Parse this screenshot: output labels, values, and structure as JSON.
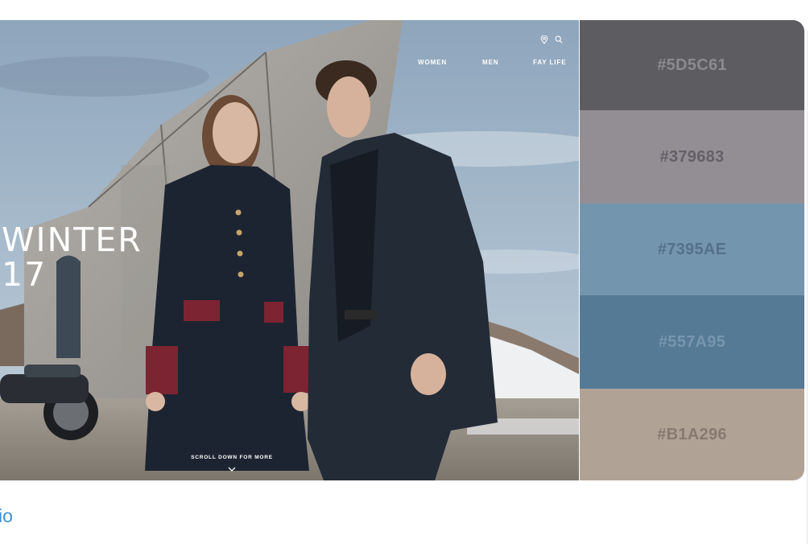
{
  "hero": {
    "nav_icons": [
      "location-pin-icon",
      "search-icon"
    ],
    "nav": [
      "WOMEN",
      "MEN",
      "FAY LIFE"
    ],
    "title_lines": [
      "WINTER",
      "17"
    ],
    "scroll_text": "SCROLL DOWN FOR MORE",
    "scroll_icon": "chevron-down-icon"
  },
  "palette": [
    {
      "label": "#5D5C61",
      "color": "#5D5C61"
    },
    {
      "label": "#379683",
      "color": "#938E94"
    },
    {
      "label": "#7395AE",
      "color": "#7395AE"
    },
    {
      "label": "#557A95",
      "color": "#557A95"
    },
    {
      "label": "#B1A296",
      "color": "#B1A296"
    }
  ],
  "footer": {
    "link": "io"
  }
}
